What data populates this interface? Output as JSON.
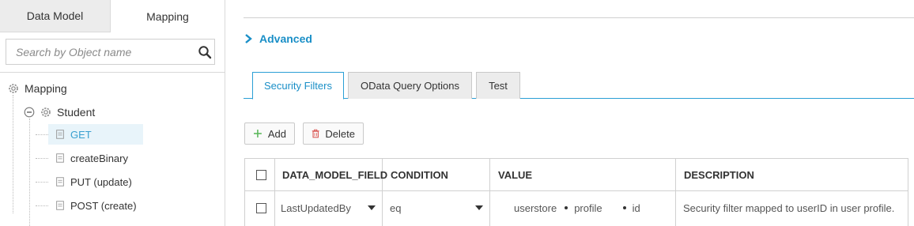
{
  "left_panel": {
    "tabs": [
      "Data Model",
      "Mapping"
    ],
    "search": {
      "placeholder": "Search by Object name",
      "value": ""
    },
    "tree": {
      "root": "Mapping",
      "child": "Student",
      "items": [
        "GET",
        "createBinary",
        "PUT (update)",
        "POST (create)"
      ]
    }
  },
  "advanced": {
    "label": "Advanced"
  },
  "tabs": [
    "Security Filters",
    "OData Query Options",
    "Test"
  ],
  "toolbar": {
    "add_label": "Add",
    "delete_label": "Delete"
  },
  "table": {
    "headers": [
      "DATA_MODEL_FIELD",
      "CONDITION",
      "VALUE",
      "DESCRIPTION"
    ],
    "rows": [
      {
        "field": "LastUpdatedBy",
        "condition": "eq",
        "value_parts": [
          "userstore",
          "profile",
          "id"
        ],
        "description": "Security filter mapped to userID in user profile."
      }
    ]
  },
  "colors": {
    "accent": "#1a8fc7",
    "delete_icon": "#d9534f",
    "add_icon": "#5cb85c"
  }
}
